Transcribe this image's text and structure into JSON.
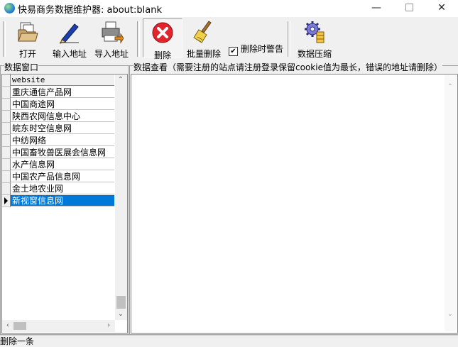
{
  "window": {
    "title": "快易商务数据维护器: about:blank"
  },
  "toolbar": {
    "open": "打开",
    "input_address": "输入地址",
    "import_address": "导入地址",
    "delete": "删除",
    "batch_delete": "批量删除",
    "warn_on_delete": "删除时警告",
    "warn_checked": "✔",
    "compress": "数据压缩"
  },
  "data_window": {
    "label": "数据窗口",
    "column": "website",
    "rows": [
      "重庆通信产品网",
      "中国商途网",
      "陕西农网信息中心",
      "皖东时空信息网",
      "中纺网络",
      "中国畜牧兽医展会信息网",
      "水产信息网",
      "中国农产品信息网",
      "金土地农业网",
      "新视窗信息网"
    ],
    "selected_index": 9
  },
  "viewer": {
    "label": "数据查看（需要注册的站点请注册登录保留cookie值为最长，错误的地址请删除）"
  },
  "status": {
    "text": "删除一条"
  }
}
